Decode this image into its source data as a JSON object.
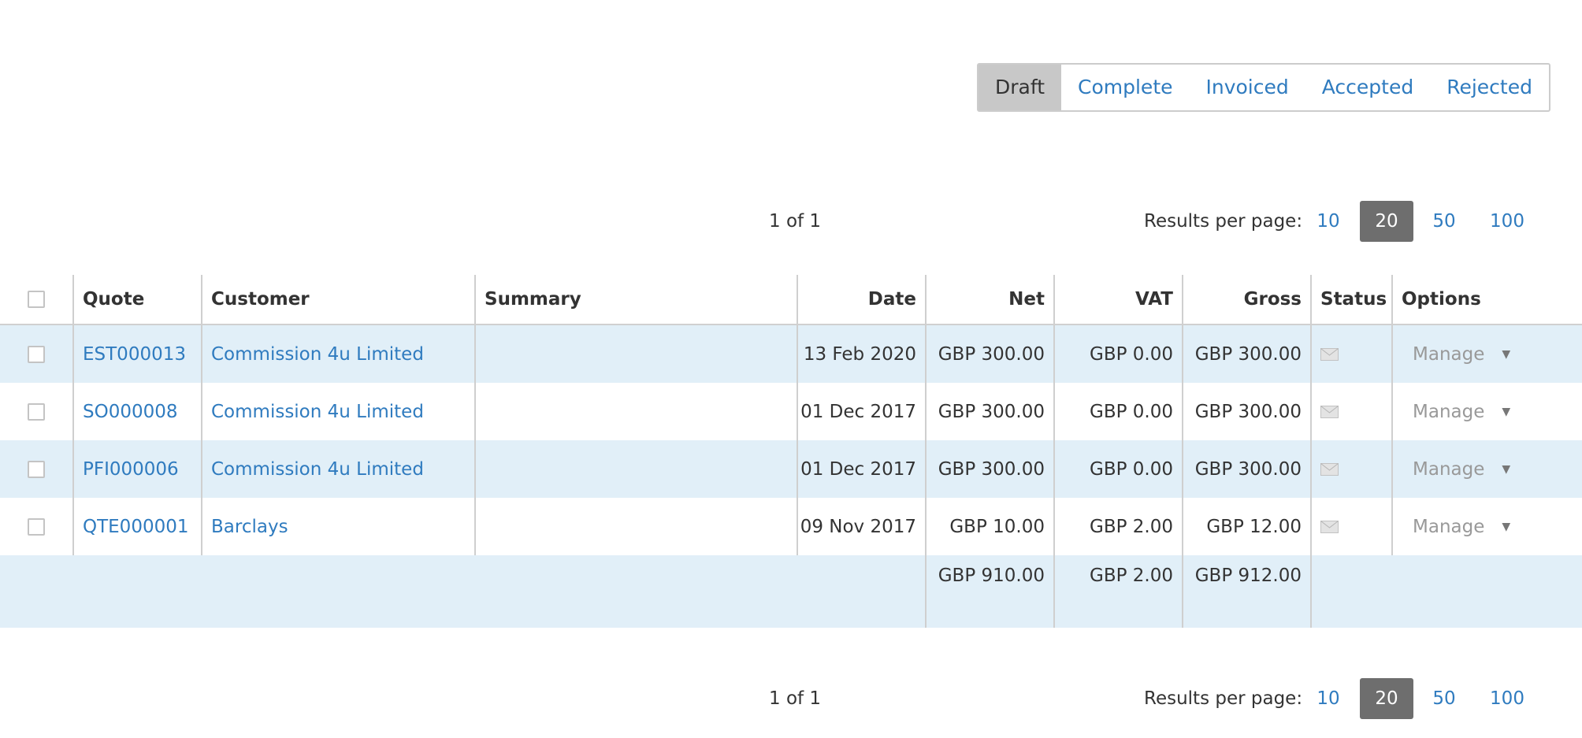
{
  "status_tabs": [
    {
      "label": "Draft",
      "active": true
    },
    {
      "label": "Complete",
      "active": false
    },
    {
      "label": "Invoiced",
      "active": false
    },
    {
      "label": "Accepted",
      "active": false
    },
    {
      "label": "Rejected",
      "active": false
    }
  ],
  "pagination": {
    "page_info": "1 of 1",
    "results_label": "Results per page:",
    "options": [
      "10",
      "20",
      "50",
      "100"
    ],
    "selected": "20"
  },
  "table": {
    "columns": {
      "quote": "Quote",
      "customer": "Customer",
      "summary": "Summary",
      "date": "Date",
      "net": "Net",
      "vat": "VAT",
      "gross": "Gross",
      "status": "Status",
      "options": "Options"
    },
    "rows": [
      {
        "quote": "EST000013",
        "customer": "Commission 4u Limited",
        "summary": "",
        "date": "13 Feb 2020",
        "net": "GBP 300.00",
        "vat": "GBP 0.00",
        "gross": "GBP 300.00",
        "status_icon": "envelope-icon",
        "action": "Manage"
      },
      {
        "quote": "SO000008",
        "customer": "Commission 4u Limited",
        "summary": "",
        "date": "01 Dec 2017",
        "net": "GBP 300.00",
        "vat": "GBP 0.00",
        "gross": "GBP 300.00",
        "status_icon": "envelope-icon",
        "action": "Manage"
      },
      {
        "quote": "PFI000006",
        "customer": "Commission 4u Limited",
        "summary": "",
        "date": "01 Dec 2017",
        "net": "GBP 300.00",
        "vat": "GBP 0.00",
        "gross": "GBP 300.00",
        "status_icon": "envelope-icon",
        "action": "Manage"
      },
      {
        "quote": "QTE000001",
        "customer": "Barclays",
        "summary": "",
        "date": "09 Nov 2017",
        "net": "GBP 10.00",
        "vat": "GBP 2.00",
        "gross": "GBP 12.00",
        "status_icon": "envelope-icon",
        "action": "Manage"
      }
    ],
    "totals": {
      "net": "GBP 910.00",
      "vat": "GBP 2.00",
      "gross": "GBP 912.00"
    }
  },
  "colors": {
    "link": "#2f7bbf",
    "row_stripe": "#e1eff8",
    "active_tab": "#c8c8c8",
    "active_page": "#6e6e6e"
  }
}
